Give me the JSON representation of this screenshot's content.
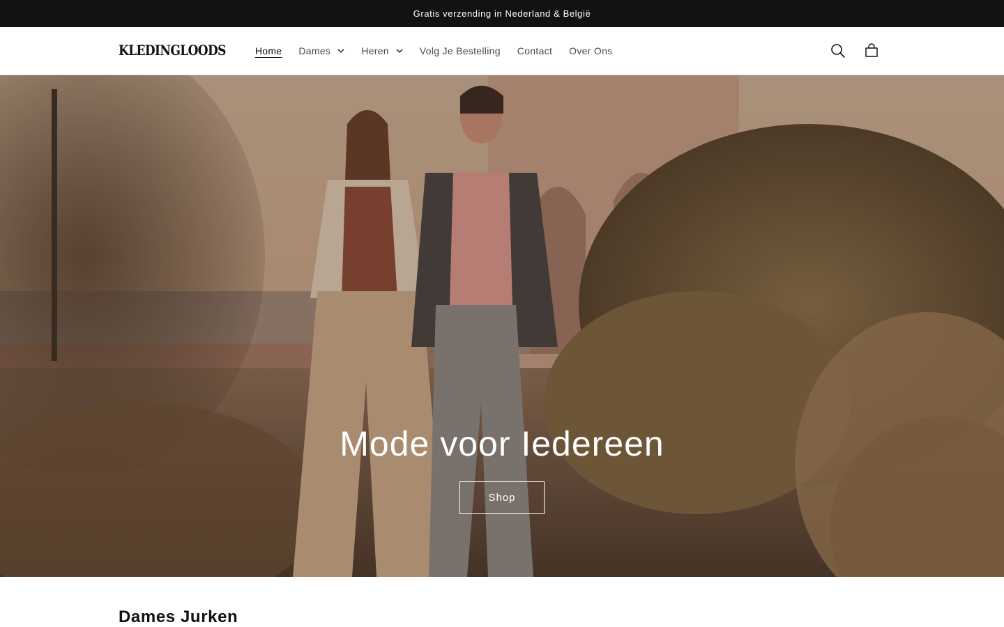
{
  "announcement": {
    "text": "Gratis verzending in Nederland & België"
  },
  "header": {
    "logo": "KLEDINGLOODS",
    "nav": [
      {
        "label": "Home",
        "active": true,
        "dropdown": false
      },
      {
        "label": "Dames",
        "active": false,
        "dropdown": true
      },
      {
        "label": "Heren",
        "active": false,
        "dropdown": true
      },
      {
        "label": "Volg Je Bestelling",
        "active": false,
        "dropdown": false
      },
      {
        "label": "Contact",
        "active": false,
        "dropdown": false
      },
      {
        "label": "Over Ons",
        "active": false,
        "dropdown": false
      }
    ],
    "icons": [
      "search-icon",
      "cart-icon"
    ]
  },
  "hero": {
    "title": "Mode voor Iedereen",
    "button_label": "Shop"
  },
  "collection": {
    "heading": "Dames Jurken"
  },
  "colors": {
    "announcement_bg": "#121212",
    "text": "#121212",
    "hero_text": "#ffffff"
  }
}
